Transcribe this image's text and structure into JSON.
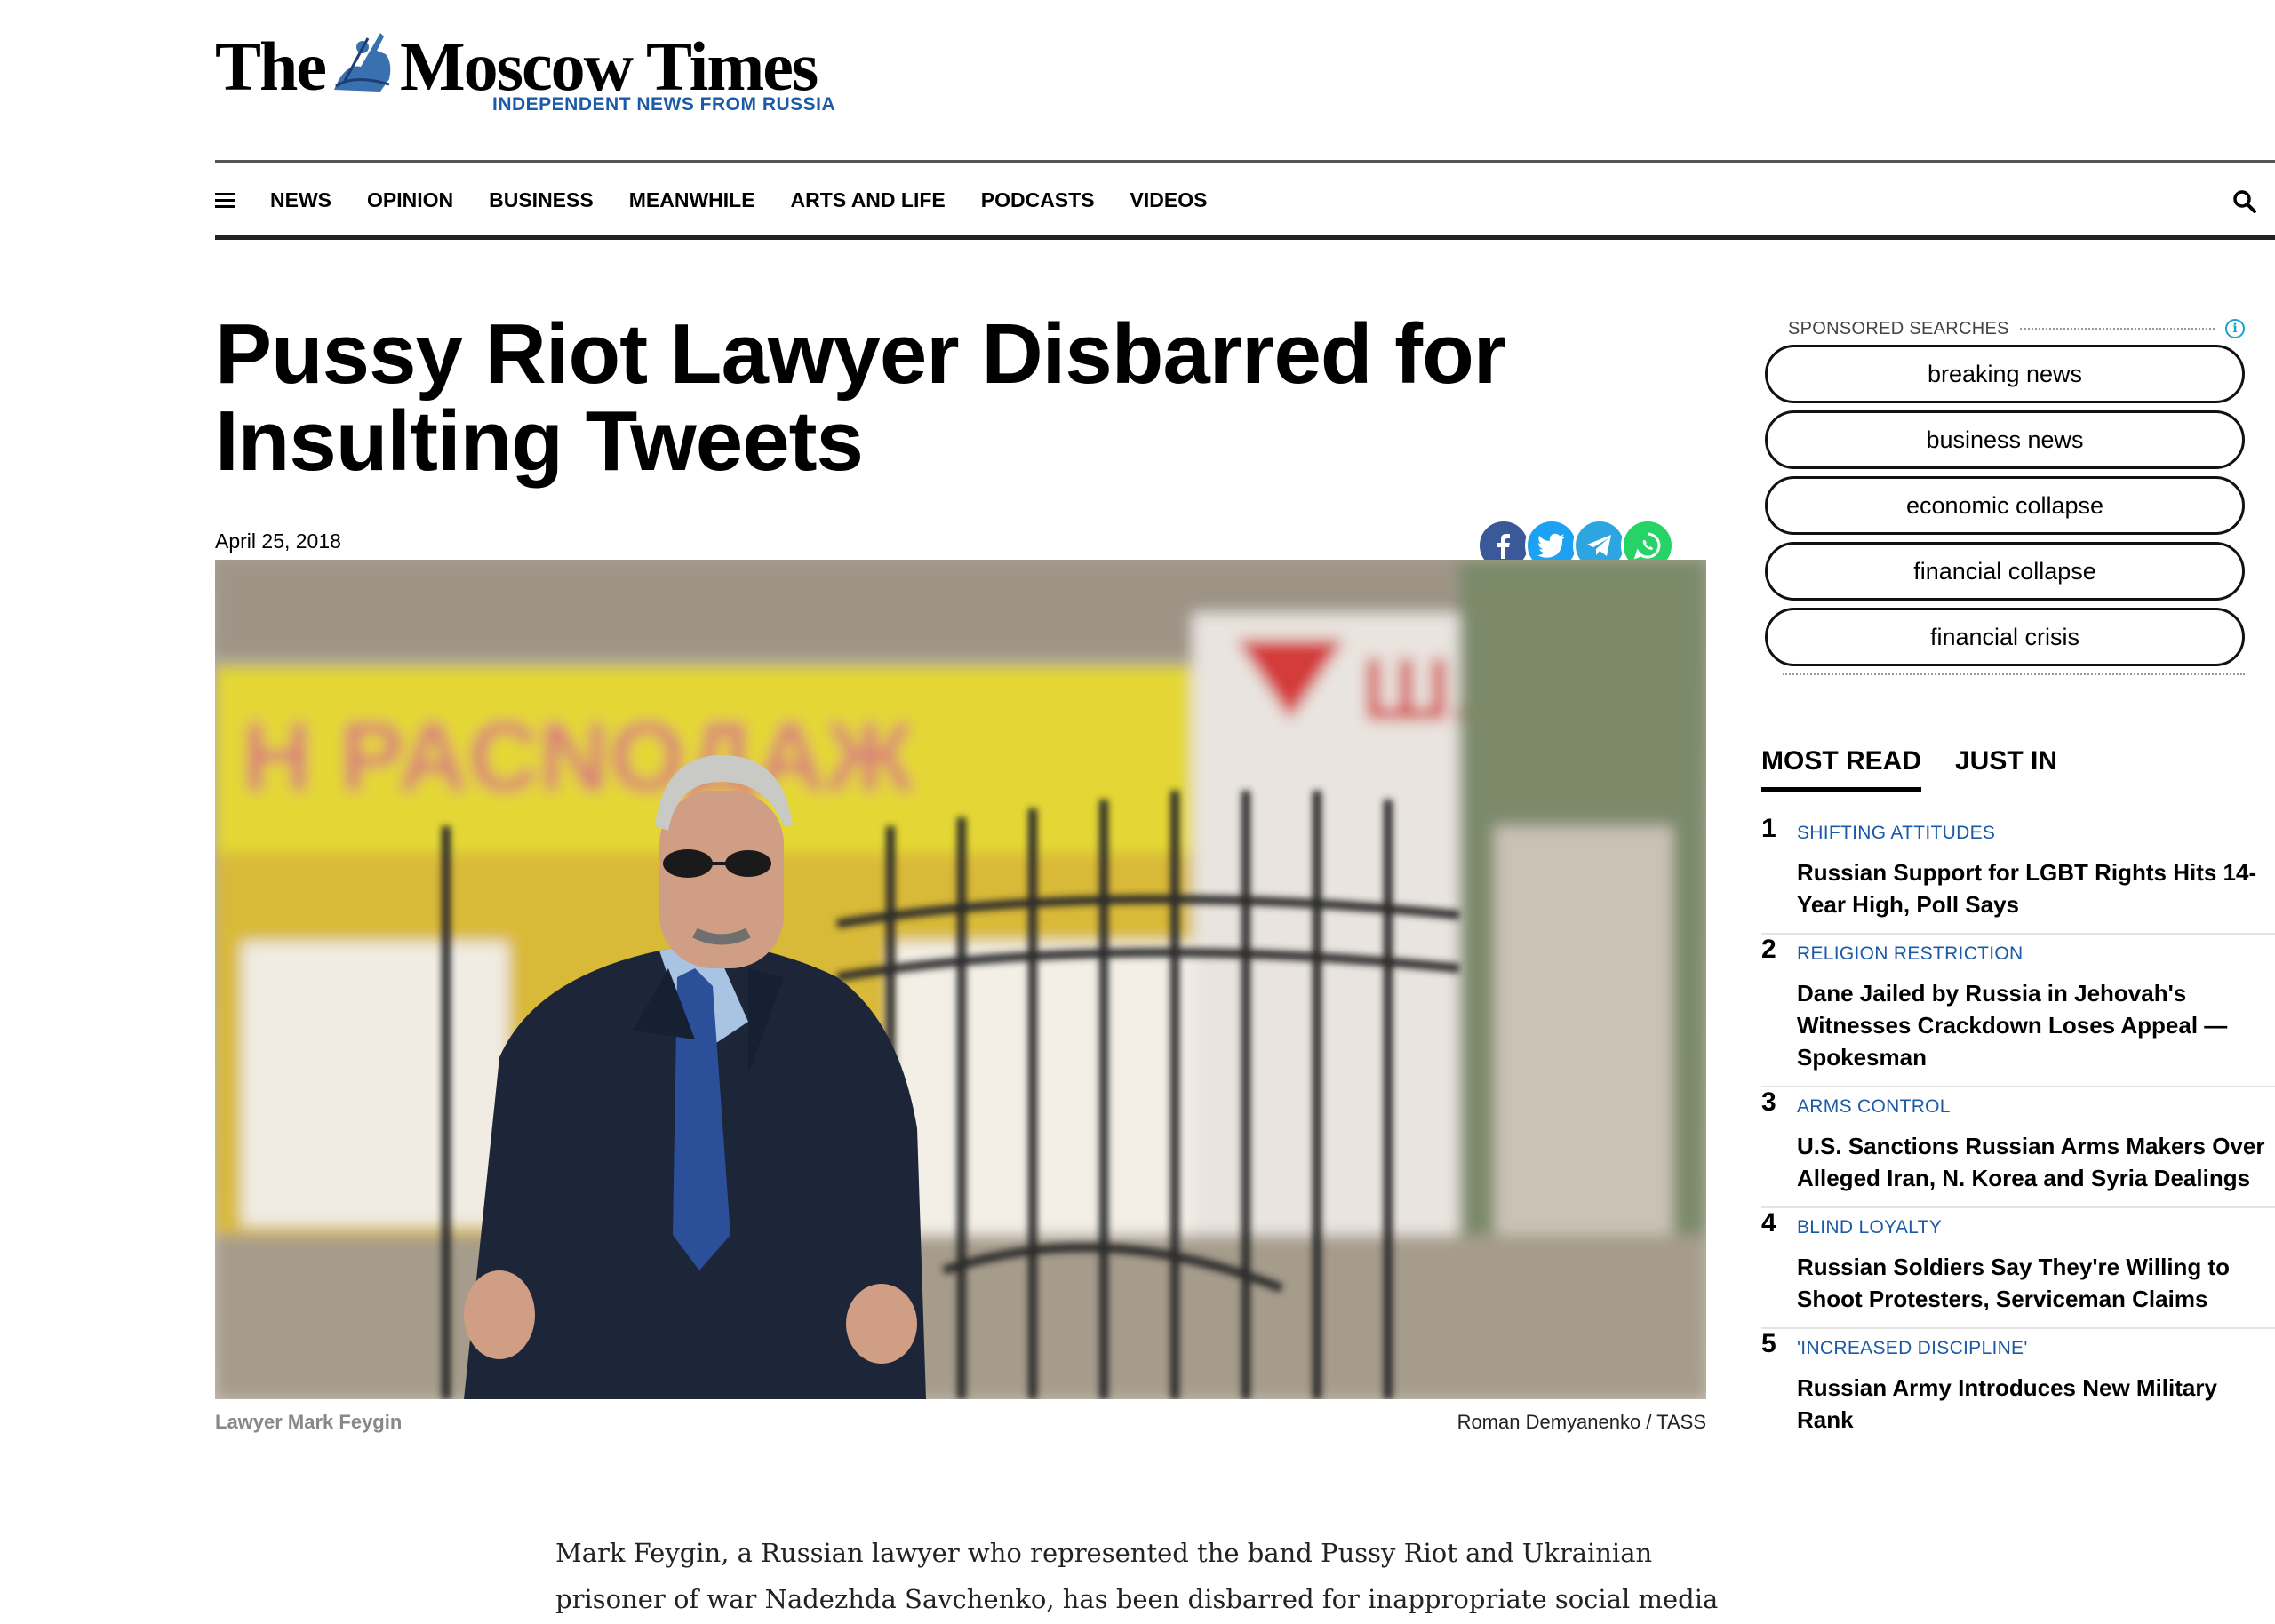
{
  "logo": {
    "title_left": "The",
    "title_right": "Moscow Times",
    "tagline": "INDEPENDENT NEWS FROM RUSSIA"
  },
  "nav": {
    "items": [
      "NEWS",
      "OPINION",
      "BUSINESS",
      "MEANWHILE",
      "ARTS AND LIFE",
      "PODCASTS",
      "VIDEOS"
    ]
  },
  "article": {
    "headline": "Pussy Riot Lawyer Disbarred for Insulting Tweets",
    "date": "April 25, 2018",
    "caption": "Lawyer Mark Feygin",
    "credit": "Roman Demyanenko / TASS",
    "lede": "Mark Feygin, a Russian lawyer who represented the band Pussy Riot and Ukrainian prisoner of war Nadezhda Savchenko, has been disbarred for inappropriate social media posts."
  },
  "sponsored": {
    "label": "SPONSORED SEARCHES",
    "info": "i",
    "items": [
      "breaking news",
      "business news",
      "economic collapse",
      "financial collapse",
      "financial crisis"
    ]
  },
  "tabs": {
    "active": "MOST READ",
    "other": "JUST IN"
  },
  "most_read": [
    {
      "num": "1",
      "category": "SHIFTING ATTITUDES",
      "title": "Russian Support for LGBT Rights Hits 14-Year High, Poll Says"
    },
    {
      "num": "2",
      "category": "RELIGION RESTRICTION",
      "title": "Dane Jailed by Russia in Jehovah's Witnesses Crackdown Loses Appeal — Spokesman"
    },
    {
      "num": "3",
      "category": "ARMS CONTROL",
      "title": "U.S. Sanctions Russian Arms Makers Over Alleged Iran, N. Korea and Syria Dealings"
    },
    {
      "num": "4",
      "category": "BLIND LOYALTY",
      "title": "Russian Soldiers Say They're Willing to Shoot Protesters, Serviceman Claims"
    },
    {
      "num": "5",
      "category": "'INCREASED DISCIPLINE'",
      "title": "Russian Army Introduces New Military Rank"
    }
  ],
  "colors": {
    "brand_blue": "#1a5aa8",
    "facebook": "#3b5998",
    "twitter": "#1da1f2",
    "telegram": "#2ca5e0",
    "whatsapp": "#25d366"
  },
  "icons": {
    "menu": "hamburger-icon",
    "search": "search-icon",
    "share": [
      "facebook-icon",
      "twitter-icon",
      "telegram-icon",
      "whatsapp-icon"
    ]
  }
}
